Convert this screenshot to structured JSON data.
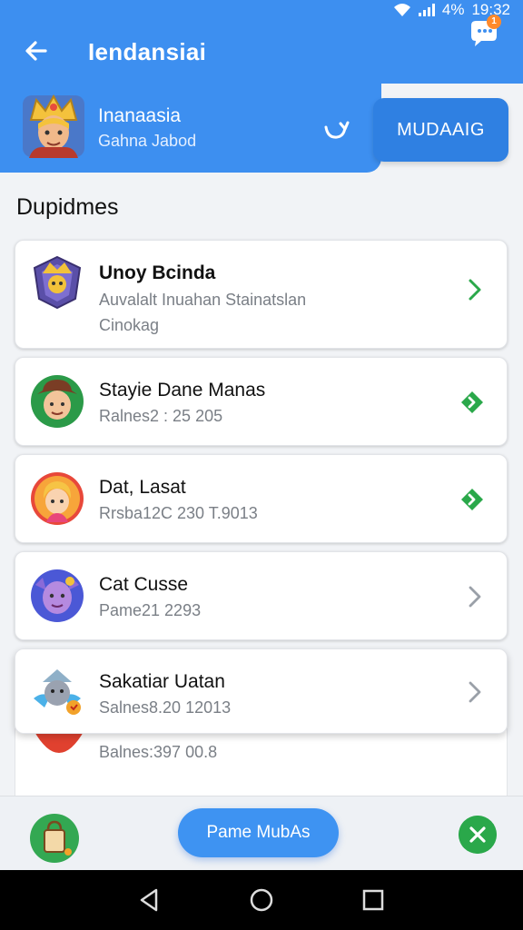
{
  "status": {
    "battery": "4%",
    "time": "19:32"
  },
  "appbar": {
    "title": "Iendansiai",
    "chat_badge": "1"
  },
  "hero": {
    "name": "Inanaasia",
    "subtitle": "Gahna Jabod",
    "button_label": "MUDAAIG"
  },
  "section": {
    "title": "Dupidmes"
  },
  "list": [
    {
      "title": "Unoy Bcinda",
      "sub1": "Auvalalt Inuahan Stainatslan",
      "sub2": "Cinokag",
      "chevron": "green-chevron"
    },
    {
      "title": "Stayie Dane Manas",
      "sub1": "Ralnes2 : 25 205",
      "chevron": "green-circle-chevron"
    },
    {
      "title": "Dat, Lasat",
      "sub1": "Rrsba12C 230 T.9013",
      "chevron": "green-circle-chevron"
    },
    {
      "title": "Cat Cusse",
      "sub1": "Pame21 2293",
      "chevron": "gray-chevron"
    },
    {
      "title": "Sakatiar Uatan",
      "sub1": "Salnes8.20 12013",
      "chevron": "gray-chevron"
    }
  ],
  "partial": {
    "sub1": "Balnes:397 00.8"
  },
  "bottom": {
    "pill_label": "Pame MubAs"
  },
  "colors": {
    "primary": "#3d8ff0",
    "button": "#2f80e2",
    "green": "#2aa84a"
  }
}
